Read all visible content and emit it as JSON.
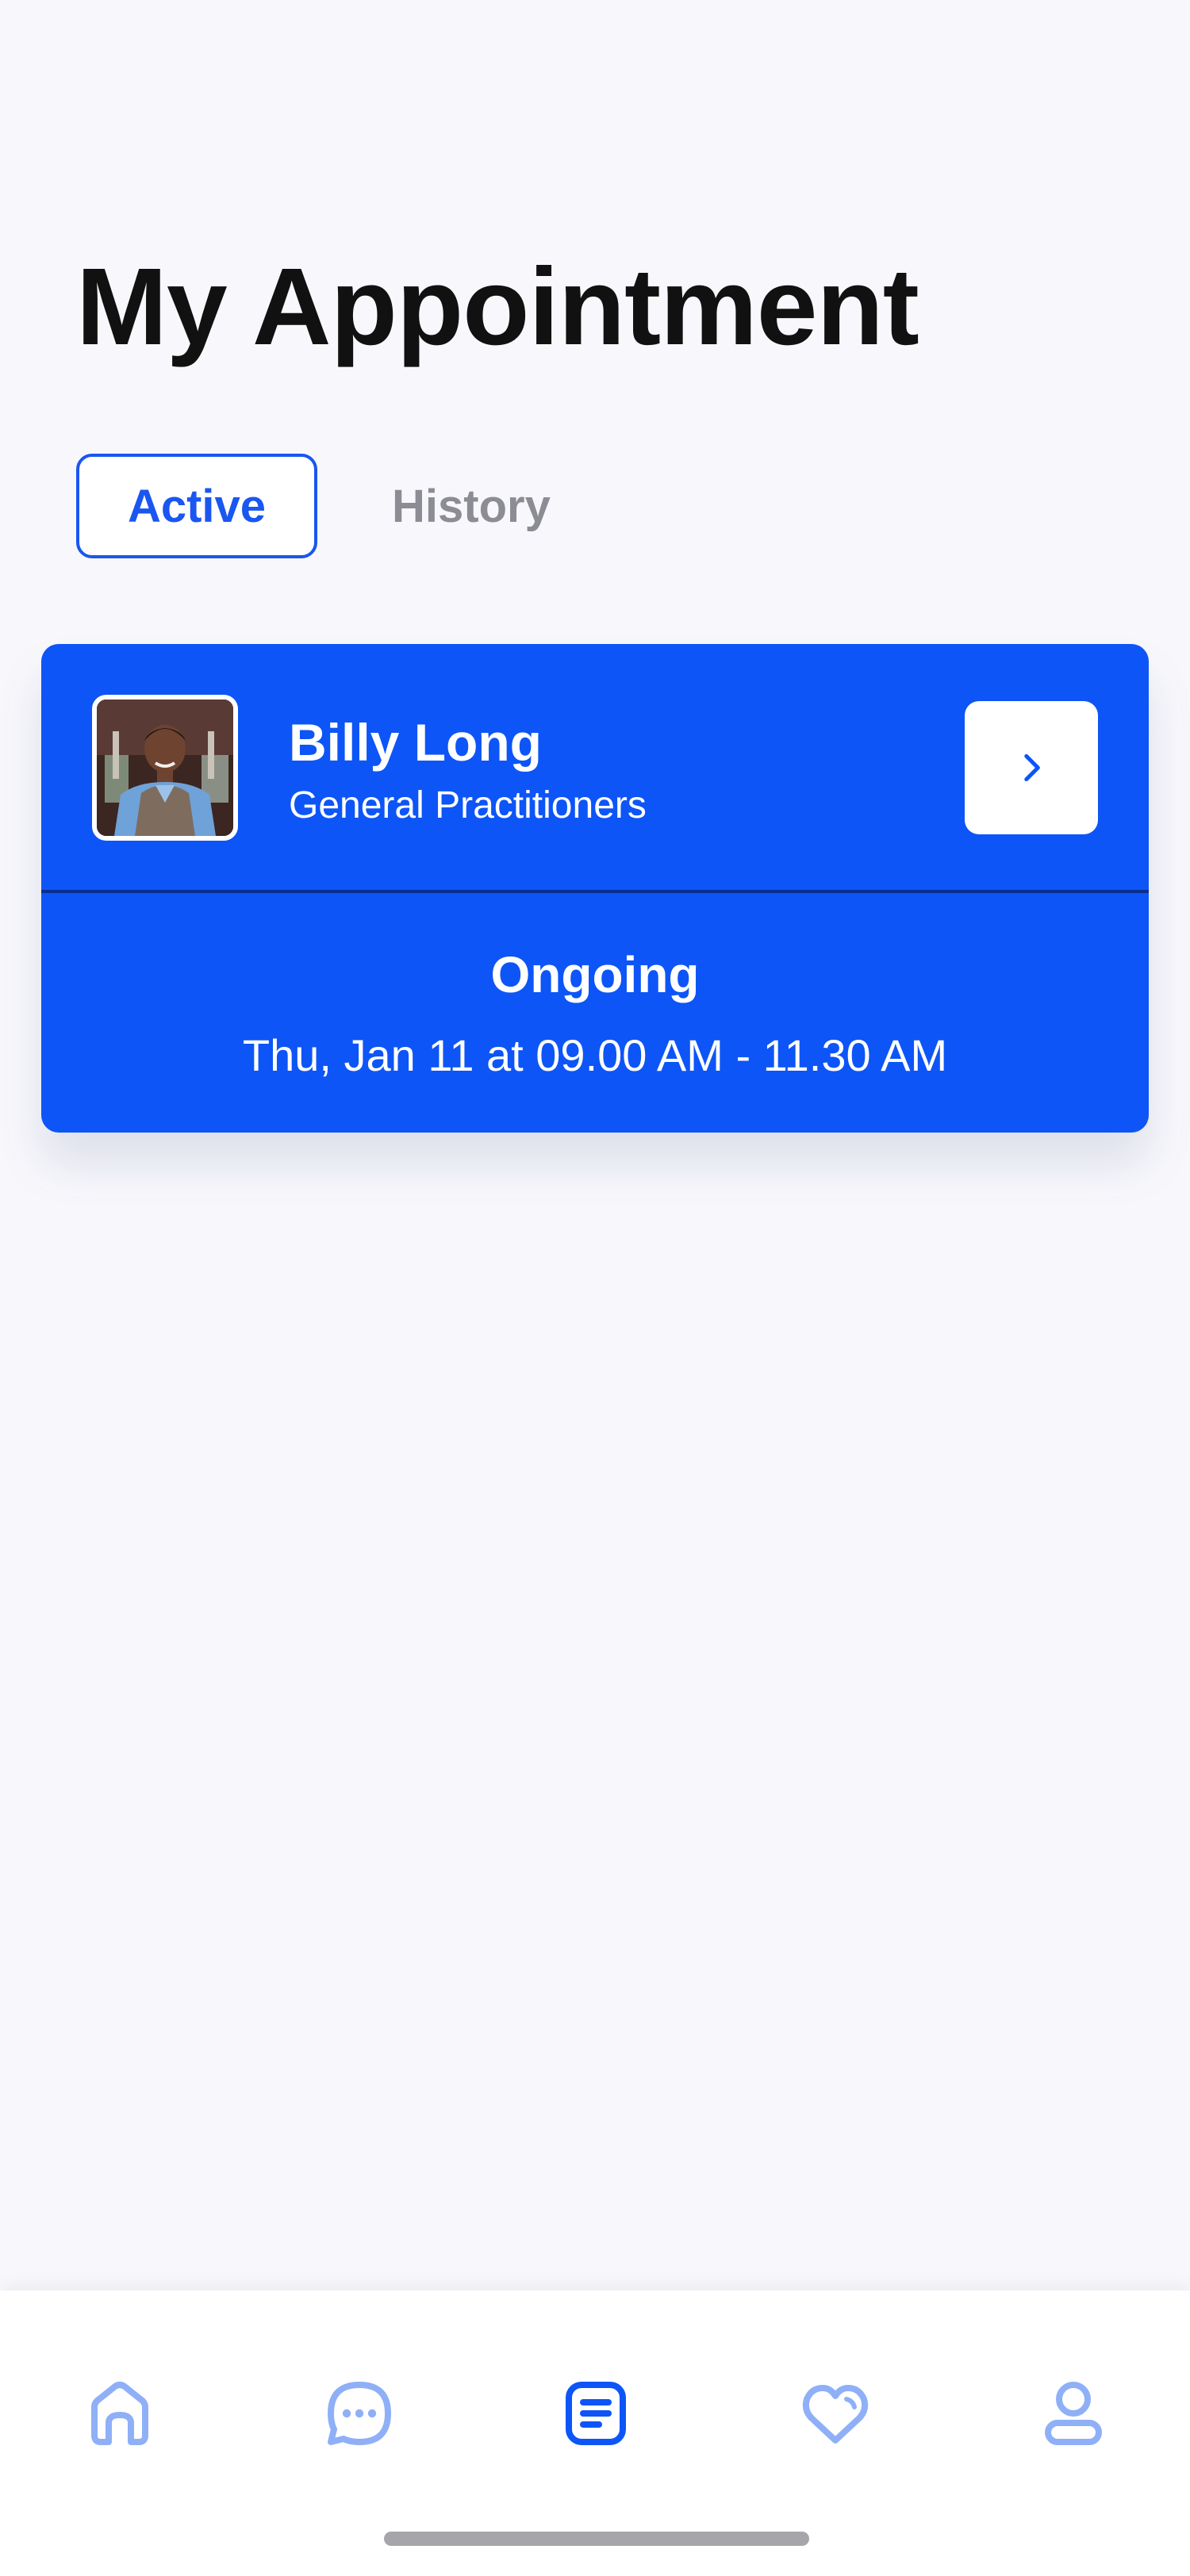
{
  "header": {
    "title": "My Appointment"
  },
  "tabs": [
    {
      "label": "Active",
      "selected": true
    },
    {
      "label": "History",
      "selected": false
    }
  ],
  "appointment": {
    "doctor_name": "Billy Long",
    "specialty": "General Practitioners",
    "status": "Ongoing",
    "schedule": "Thu, Jan 11 at 09.00 AM - 11.30 AM"
  },
  "bottom_nav": [
    {
      "icon": "home-icon",
      "active": false
    },
    {
      "icon": "chat-icon",
      "active": false
    },
    {
      "icon": "appointment-list-icon",
      "active": true
    },
    {
      "icon": "heart-icon",
      "active": false
    },
    {
      "icon": "profile-icon",
      "active": false
    }
  ],
  "colors": {
    "primary": "#0d55f7",
    "nav_inactive": "#8fb0f7",
    "background": "#f8f8fc"
  }
}
